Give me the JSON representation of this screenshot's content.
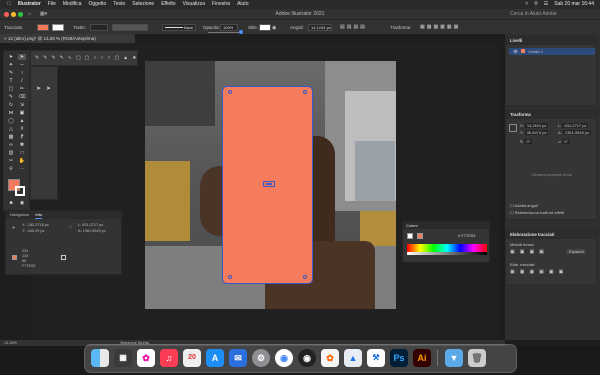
{
  "menubar": {
    "app": "Illustrator",
    "items": [
      "File",
      "Modifica",
      "Oggetto",
      "Testo",
      "Selezione",
      "Effetto",
      "Visualizza",
      "Finestra",
      "Aiuto"
    ],
    "datetime": "Sab 20 mar 16:44"
  },
  "titlebar": {
    "title": "Adobe Illustrator 2021",
    "search_placeholder": "Cerca in Aiuto Adobe"
  },
  "controlbar": {
    "selection_label": "Tracciato",
    "stroke_label": "Tratto:",
    "stroke_value": "",
    "brush_label": "Base",
    "opacity_label": "Opacità:",
    "opacity_value": "100%",
    "style_label": "Stile:",
    "corners_label": "Angoli:",
    "corners_value": "14,1244 px",
    "transform_label": "Trasforma"
  },
  "document": {
    "tab_label": "12 (altro).png* @ 13,28 % (RGB/Anteprima)",
    "zoom": "13,28%",
    "status_tool": "Selezione Diretta"
  },
  "info_panel": {
    "tabs": [
      "Navigatore",
      "Info"
    ],
    "x_label": "X:",
    "x_value": "-182,3718 px",
    "y_label": "Y:",
    "y_value": "-445,29 px",
    "w_label": "L:",
    "w_value": "631,2717 px",
    "h_label": "A:",
    "h_value": "1361,9549 px",
    "r_value": "231",
    "g_value": "115",
    "b_value": "85",
    "hex_value": "F77E53"
  },
  "color_panel": {
    "title": "Colore",
    "hex": "F77E53"
  },
  "right_panels": {
    "layers_title": "Livelli",
    "layer_name": "Livello 1",
    "transform_title": "Trasforma",
    "x_value": "14,2611 px",
    "y_value": "36,8474 px",
    "w_value": "631,2717 px",
    "h_value": "1361,9549 px",
    "angle_value": "0°",
    "shear_value": "0°",
    "placeholder_note": "Nessuna proprietà forma",
    "scale_corners": "Adatta angoli",
    "scale_strokes": "Ridimensiona tratti ed effetti",
    "pathfinder_title": "Elaborazione tracciati",
    "shape_modes": "Metodi forma:",
    "pathfinders": "Elab. tracciati:",
    "expand": "Espandi"
  },
  "colors": {
    "accent": "#f47b5c",
    "ps_blue": "#31a8ff",
    "ai_orange": "#ff9a00"
  },
  "dock": {
    "ps_label": "Ps",
    "ai_label": "Ai"
  }
}
